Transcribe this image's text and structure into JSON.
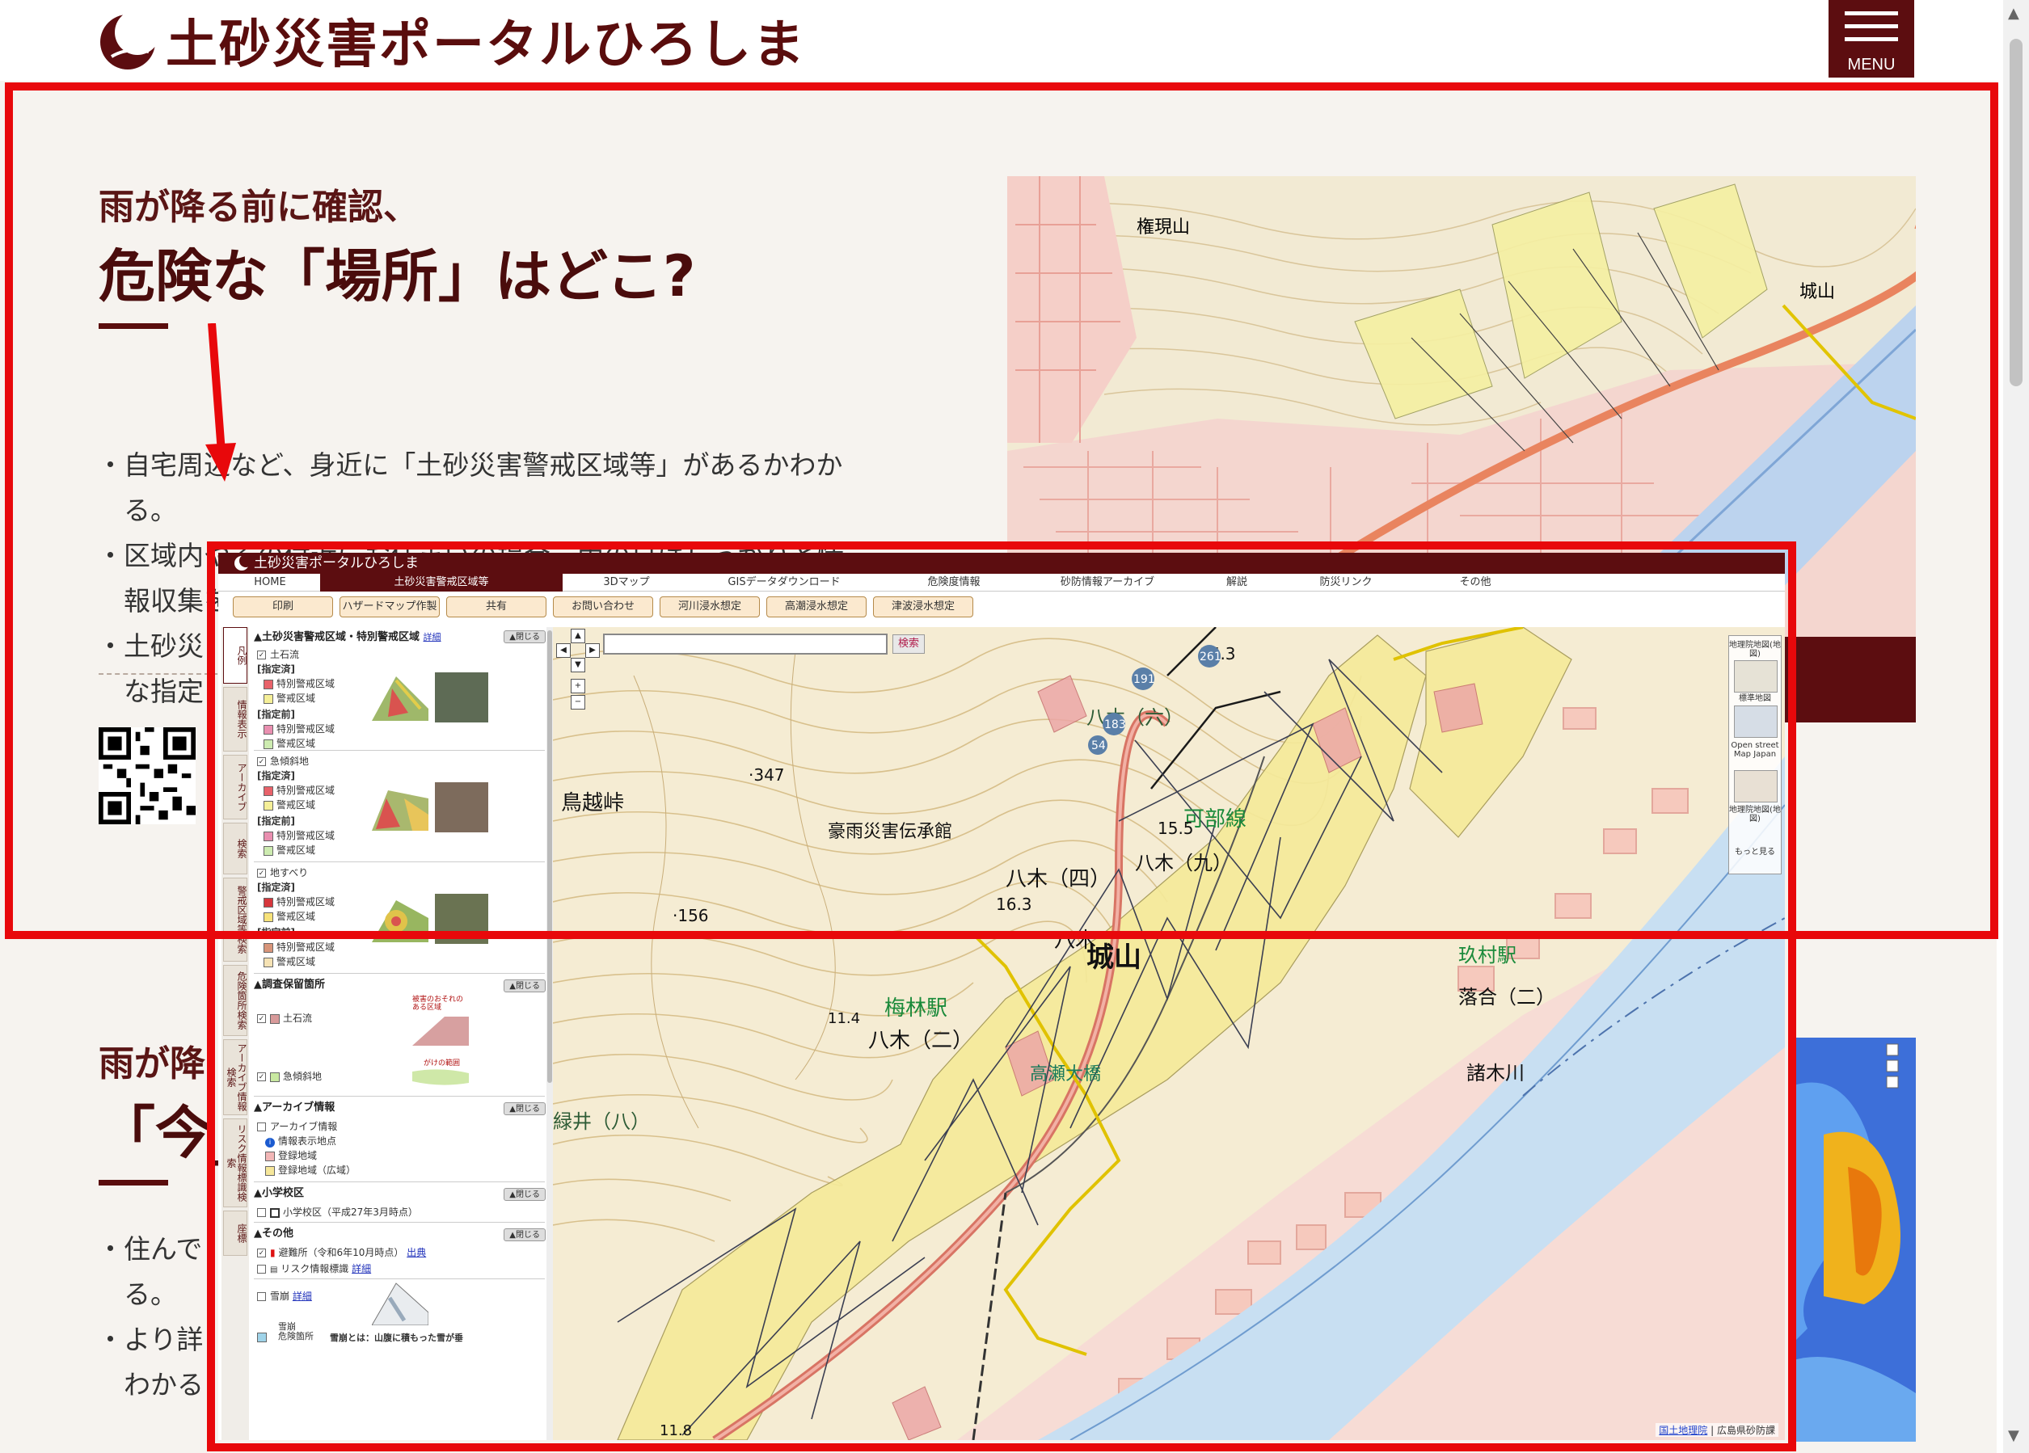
{
  "site": {
    "title": "土砂災害ポータルひろしま",
    "menu_label": "MENU"
  },
  "hero": {
    "subtitle": "雨が降る前に確認、",
    "title": "危険な「場所」はどこ?",
    "bullets": [
      "・自宅周辺など、身近に「土砂災害警戒区域等」があるかわか",
      "　る。",
      "・区域内やその付近にお住まいの場合、雨の日はしっかりと情",
      "　報収集をし、いざという時に備える。",
      "・土砂災",
      "　な指定"
    ]
  },
  "section2": {
    "subtitle": "雨が降",
    "title": "「今_",
    "bullets": [
      "・住んで",
      "　る。",
      "・より詳",
      "　わかる"
    ]
  },
  "app": {
    "title": "土砂災害ポータルひろしま",
    "nav": [
      "HOME",
      "土砂災害警戒区域等",
      "3Dマップ",
      "GISデータダウンロード",
      "危険度情報",
      "砂防情報アーカイブ",
      "解説",
      "防災リンク",
      "その他"
    ],
    "active_nav": "土砂災害警戒区域等",
    "toolbar": [
      "印刷",
      "ハザードマップ作製",
      "共有",
      "お問い合わせ",
      "河川浸水想定",
      "高潮浸水想定",
      "津波浸水想定"
    ],
    "side_tabs": [
      "凡例",
      "情報表示",
      "アーカイブ",
      "検索",
      "警戒区域等検索",
      "危険箇所検索",
      "アーカイブ情報検索",
      "リスク情報標識検索",
      "座標"
    ],
    "legend": {
      "main_header": "土砂災害警戒区域・特別警戒区域",
      "detail_link": "詳細",
      "close_label": "▲閉じる",
      "debris": "土石流",
      "steep": "急傾斜地",
      "landslide": "地すべり",
      "designated": "[指定済]",
      "pre_designated": "[指定前]",
      "special_zone": "特別警戒区域",
      "warning_zone": "警戒区域",
      "reserved_header": "調査保留箇所",
      "reserved_debris": "土石流",
      "reserved_steep": "急傾斜地",
      "reserved_note1": "被害のおそれのある区域",
      "reserved_note2": "がけの範囲",
      "archive_header": "アーカイブ情報",
      "archive_info": "アーカイブ情報",
      "info_point": "情報表示地点",
      "registered_area": "登録地域",
      "registered_wide": "登録地域（広域）",
      "school_header": "小学校区",
      "school_item": "小学校区（平成27年3月時点）",
      "other_header": "その他",
      "shelter": "避難所（令和6年10月時点）",
      "shelter_link": "出典",
      "risk_sign": "リスク情報標識",
      "risk_link": "詳細",
      "avalanche": "雪崩",
      "avalanche_link": "詳細",
      "avalanche_zone_1": "雪崩",
      "avalanche_zone_2": "危険箇所",
      "avalanche_note": "雪崩とは：山腹に積もった雪が垂"
    },
    "search_button": "検索",
    "basemaps": [
      "地理院地図(地図)",
      "標準地図",
      "Open street Map Japan",
      "地理院地図(地図)",
      "もっと見る"
    ],
    "attribution_1": "国土地理院",
    "attribution_sep": " | ",
    "attribution_2": "広島県砂防課",
    "map_labels": {
      "elev347": "·347",
      "elev156": "·156",
      "pass": "鳥越峠",
      "museum": "豪雨災害伝承館",
      "yagi4": "八木（四）",
      "yagi9": "八木（九）",
      "yagi2": "八木（二）",
      "yagi6": "八木（六）",
      "yagi": "八木",
      "kabe": "可部線",
      "shiroyama": "城山",
      "umebayashi": "梅林駅",
      "bridge": "高瀬大橋",
      "kumura": "玖村駅",
      "ochiai": "落合（二）",
      "morokigawa": "諸木川",
      "midorii": "緑井（八）",
      "e153": "15.3",
      "e155": "15.5",
      "e163": "16.3",
      "e114": "11.4",
      "e118": "11.8",
      "r183": "183",
      "r191": "191",
      "r261": "261",
      "r54": "54"
    }
  },
  "colors": {
    "brand": "#5c0d10",
    "annotation": "#e8080b",
    "hero_bg": "#f6f3ef"
  }
}
